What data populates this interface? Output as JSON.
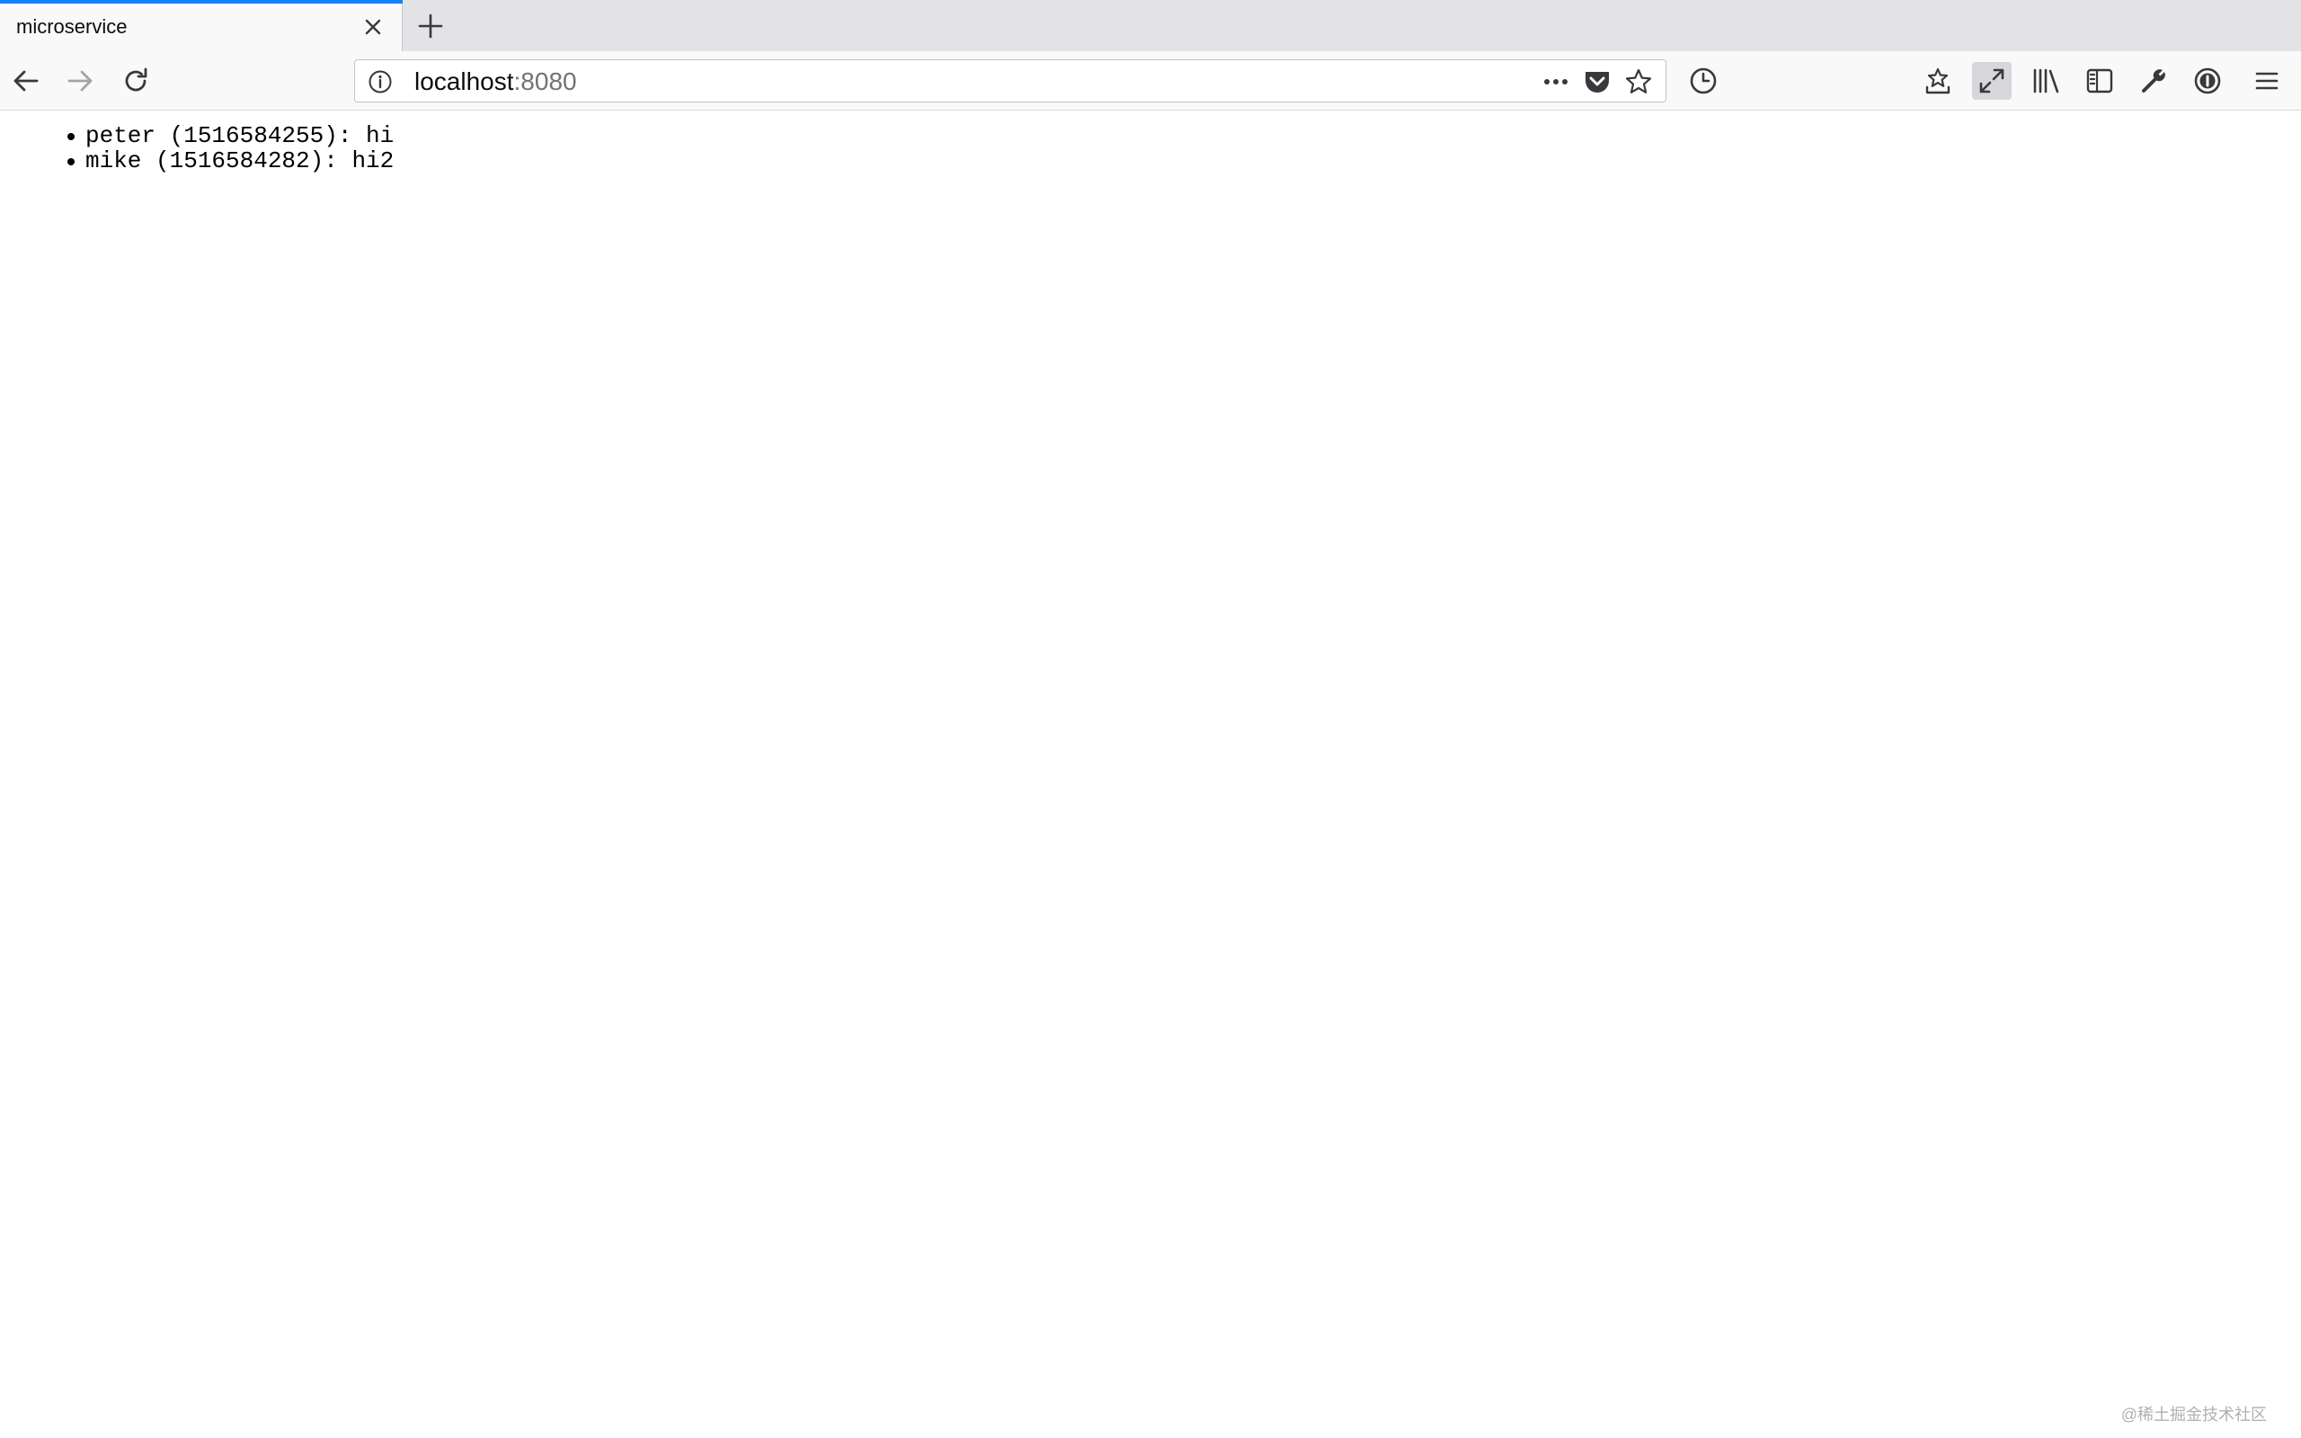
{
  "tab": {
    "title": "microservice"
  },
  "urlbar": {
    "host": "localhost",
    "port": ":8080"
  },
  "icons": {
    "tab_close": "close-icon",
    "new_tab": "plus-icon",
    "back": "arrow-left-icon",
    "forward": "arrow-right-icon",
    "reload": "reload-icon",
    "site_info": "info-icon",
    "page_actions": "more-icon",
    "pocket": "pocket-icon",
    "bookmark": "star-icon",
    "history": "clock-icon",
    "bookmarks_toolbar": "star-tray-icon",
    "fullscreen": "expand-icon",
    "library": "library-icon",
    "sidebar": "sidebar-icon",
    "developer": "wrench-icon",
    "password_manager": "password-icon",
    "menu": "hamburger-icon"
  },
  "messages": [
    {
      "user": "peter",
      "timestamp": "1516584255",
      "text": "hi",
      "display": "peter (1516584255): hi"
    },
    {
      "user": "mike",
      "timestamp": "1516584282",
      "text": "hi2",
      "display": "mike (1516584282): hi2"
    }
  ],
  "watermark": "@稀土掘金技术社区",
  "colors": {
    "tab_accent": "#0a84ff",
    "toolbar_bg": "#f9f9fa",
    "tabstrip_bg": "#e3e3e6",
    "icon": "#38383d",
    "port_text": "#737373"
  }
}
